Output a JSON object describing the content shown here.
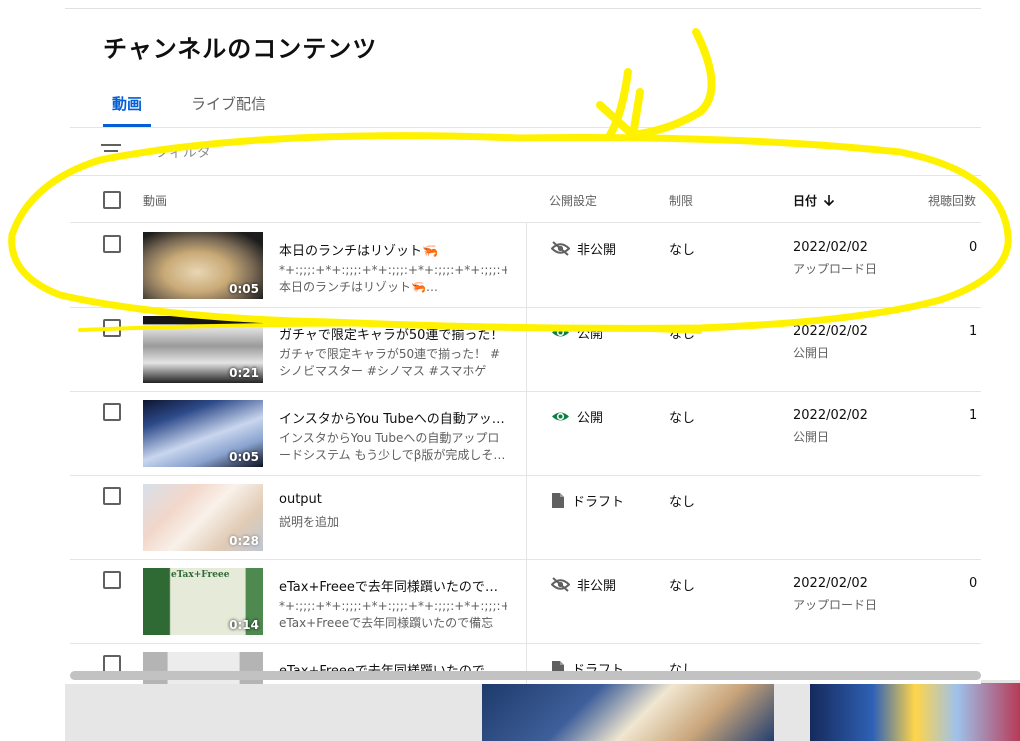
{
  "page": {
    "title": "チャンネルのコンテンツ"
  },
  "tabs": [
    {
      "label": "動画"
    },
    {
      "label": "ライブ配信"
    }
  ],
  "filter": {
    "placeholder": "フィルタ"
  },
  "columns": {
    "video": "動画",
    "visibility": "公開設定",
    "restrictions": "制限",
    "date": "日付",
    "views": "視聴回数"
  },
  "rows": [
    {
      "title": "本日のランチはリゾット🦐",
      "desc": "*+:;;;:+*+:;;;:+*+:;;;:+*+:;;;:+*+:;;;:+* 本日のランチはリゾット🦐…",
      "duration": "0:05",
      "visibility": "非公開",
      "restriction": "なし",
      "date": "2022/02/02",
      "date_label": "アップロード日",
      "views": "0",
      "thumb_colors": [
        "#d9c9b0",
        "#8a7656",
        "#111111"
      ]
    },
    {
      "title": "ガチャで限定キャラが50連で揃った！",
      "desc": "ガチャで限定キャラが50連で揃った！ #シノビマスター #シノマス #スマホゲー…",
      "duration": "0:21",
      "visibility": "公開",
      "restriction": "なし",
      "date": "2022/02/02",
      "date_label": "公開日",
      "views": "1",
      "thumb_colors": [
        "#f2f2f2",
        "#6a6a6a",
        "#141414"
      ]
    },
    {
      "title": "インスタからYou Tubeへの自動アップ…",
      "desc": "インスタからYou Tubeへの自動アップロードシステム もう少しでβ版が完成しそ…",
      "duration": "0:05",
      "visibility": "公開",
      "restriction": "なし",
      "date": "2022/02/02",
      "date_label": "公開日",
      "views": "1",
      "thumb_colors": [
        "#2d4a8a",
        "#c9d6ee",
        "#0b1020"
      ]
    },
    {
      "title": "output",
      "desc": "説明を追加",
      "duration": "0:28",
      "visibility": "ドラフト",
      "restriction": "なし",
      "date": "",
      "date_label": "",
      "views": "",
      "thumb_colors": [
        "#e8b79f",
        "#b7c4d8",
        "#c9a178"
      ]
    },
    {
      "title": "eTax+Freeeで去年同様躓いたので備…",
      "desc": "*+:;;;:+*+:;;;:+*+:;;;:+*+:;;;:+*+:;;;:+* eTax+Freeeで去年同様躓いたので備忘録…",
      "duration": "0:14",
      "visibility": "非公開",
      "restriction": "なし",
      "date": "2022/02/02",
      "date_label": "アップロード日",
      "views": "0",
      "thumb_colors": [
        "#2f6a35",
        "#e6ead8",
        "#4e8a4f"
      ],
      "thumb_text": "eTax+Freee"
    },
    {
      "title": "eTax+Freeeで去年同様躓いたので備…",
      "desc": "",
      "duration": "",
      "visibility": "ドラフト",
      "restriction": "なし",
      "date": "",
      "date_label": "",
      "views": "",
      "thumb_colors": [
        "#777777",
        "#dddddd",
        "#777777"
      ]
    }
  ],
  "annotation": {
    "color": "#fff200"
  }
}
